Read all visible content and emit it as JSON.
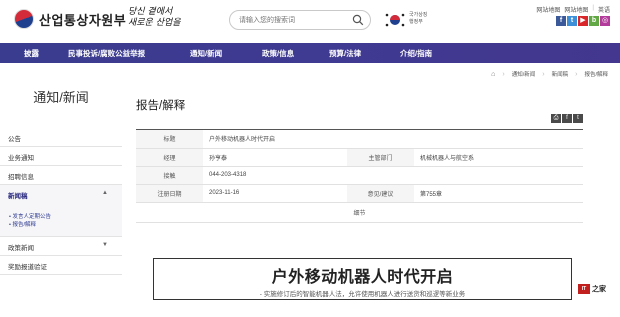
{
  "header": {
    "ministry_name": "산업통상자원부",
    "slogan": [
      "당신 곁에서",
      "새로운 산업을"
    ],
    "search_placeholder": "请输入您的搜索词",
    "gov_text": [
      "국가상징",
      "행정부"
    ],
    "util_links": [
      "网站地图",
      "网站地图",
      "英语"
    ],
    "sns": [
      {
        "icon": "facebook-icon",
        "glyph": "f",
        "color": "#3b5998"
      },
      {
        "icon": "twitter-icon",
        "glyph": "t",
        "color": "#3d8fd8"
      },
      {
        "icon": "youtube-icon",
        "glyph": "▶",
        "color": "#d8262b"
      },
      {
        "icon": "blog-icon",
        "glyph": "b",
        "color": "#62a845"
      },
      {
        "icon": "instagram-icon",
        "glyph": "◎",
        "color": "#b33b9b"
      }
    ]
  },
  "nav": [
    "披露",
    "民事投诉/腐败公益举报",
    "通知/新闻",
    "政策/信息",
    "预算/法律",
    "介绍/指南"
  ],
  "breadcrumb": [
    "通知/新闻",
    "新闻稿",
    "报告/解释"
  ],
  "sidebar": {
    "title": "通知/新闻",
    "items": [
      {
        "label": "公告",
        "chevron": ""
      },
      {
        "label": "业务通知",
        "chevron": ""
      },
      {
        "label": "招聘信息",
        "chevron": ""
      },
      {
        "label": "新闻稿",
        "chevron": "▲",
        "subs": [
          "• 发言人定期公告",
          "• 报告/解释"
        ]
      },
      {
        "label": "政策新闻",
        "chevron": "▼"
      },
      {
        "label": "奖励报道验证",
        "chevron": ""
      }
    ]
  },
  "content": {
    "page_title": "报告/解释",
    "tools": [
      "print-icon",
      "facebook-icon",
      "twitter-icon"
    ],
    "tool_glyphs": [
      "⎙",
      "f",
      "t"
    ],
    "table": {
      "title_label": "标题",
      "title_value": "户外移动机器人时代开启",
      "manager_label": "经理",
      "manager_value": "孙亨泰",
      "dept_label": "主管部门",
      "dept_value": "机械机器人与航空系",
      "contact_label": "接触",
      "contact_value": "044-203-4318",
      "date_label": "注册日期",
      "date_value": "2023-11-16",
      "views_label": "意见/建议",
      "views_value": "第755章",
      "detail_label": "细节"
    },
    "article": {
      "headline": "户外移动机器人时代开启",
      "subheadline": "- 实施修订后的智能机器人法，允许使用机器人进行送货和巡逻等新业务"
    }
  },
  "watermark": {
    "badge": "IT之家",
    "text": "IT之家"
  }
}
